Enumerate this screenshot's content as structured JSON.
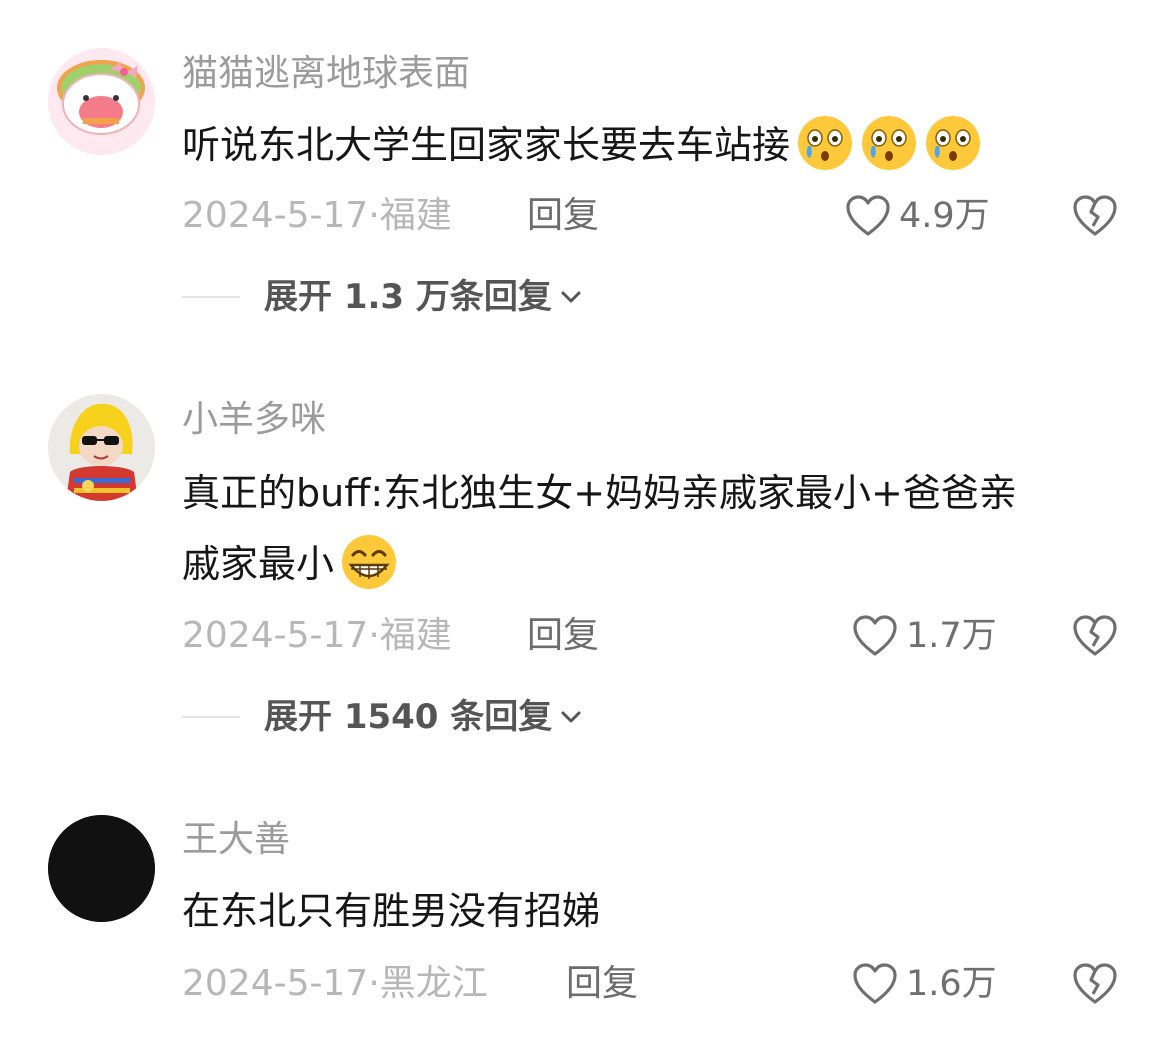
{
  "comments": [
    {
      "username": "猫猫逃离地球表面",
      "content_lines": [
        "听说东北大学生回家家长要去车站接"
      ],
      "emojis": [
        "crying-face",
        "crying-face",
        "crying-face"
      ],
      "date": "2024-5-17",
      "location": "福建",
      "meta_separator": "·",
      "reply_label": "回复",
      "like_count": "4.9万",
      "expand_label": "展开 1.3 万条回复",
      "avatar_icon": "cartoon-avatar"
    },
    {
      "username": "小羊多咪",
      "content_lines": [
        "真正的buff:东北独生女+妈妈亲戚家最小+爸爸亲",
        "戚家最小"
      ],
      "emojis": [
        "grinning-face"
      ],
      "date": "2024-5-17",
      "location": "福建",
      "meta_separator": "·",
      "reply_label": "回复",
      "like_count": "1.7万",
      "expand_label": "展开 1540 条回复",
      "avatar_icon": "photo-avatar"
    },
    {
      "username": "王大善",
      "content_lines": [
        "在东北只有胜男没有招娣"
      ],
      "emojis": [],
      "date": "2024-5-17",
      "location": "黑龙江",
      "meta_separator": "·",
      "reply_label": "回复",
      "like_count": "1.6万",
      "avatar_icon": "black-avatar"
    }
  ],
  "icons": {
    "like": "heart-outline-icon",
    "dislike": "broken-heart-icon",
    "expand": "chevron-down-icon"
  },
  "colors": {
    "username": "#9b9b9b",
    "meta": "#b7b7b7",
    "reply": "#6c6c6c",
    "content": "#161616"
  }
}
